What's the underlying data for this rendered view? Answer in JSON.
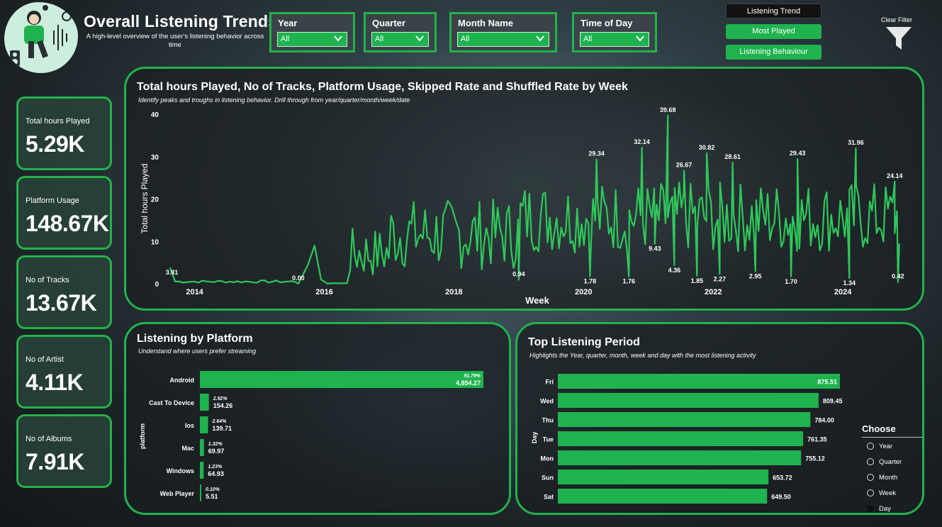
{
  "header": {
    "title": "Overall Listening Trends",
    "subtitle": "A high-level overview of the user's listening behavior across time"
  },
  "slicers": [
    {
      "label": "Year",
      "value": "All"
    },
    {
      "label": "Quarter",
      "value": "All"
    },
    {
      "label": "Month Name",
      "value": "All"
    },
    {
      "label": "Time of Day",
      "value": "All"
    }
  ],
  "nav": {
    "listening_trend": "Listening Trend",
    "most_played": "Most Played",
    "listening_behaviour": "Listening Behaviour",
    "clear_filter": "Clear Filter"
  },
  "kpis": [
    {
      "label": "Total hours Played",
      "value": "5.29K"
    },
    {
      "label": "Platform Usage",
      "value": "148.67K"
    },
    {
      "label": "No of Tracks",
      "value": "13.67K"
    },
    {
      "label": "No of Artist",
      "value": "4.11K"
    },
    {
      "label": "No of Albums",
      "value": "7.91K"
    }
  ],
  "colors": {
    "accent": "#22b24c",
    "line": "#2ec85a",
    "bar": "#1fb34f",
    "active_nav": "#121212"
  },
  "chart_data": [
    {
      "type": "line",
      "title": "Total hours Played, No of Tracks, Platform Usage, Skipped Rate and Shuffled Rate by Week",
      "subtitle": "Identify peaks and troughs in listening behavior. Drill through from year/quarter/month/week/date",
      "xlabel": "Week",
      "ylabel": "Total hours Played",
      "x_ticks": [
        "2014",
        "2016",
        "2018",
        "2020",
        "2022",
        "2024"
      ],
      "y_ticks": [
        0,
        10,
        20,
        30,
        40
      ],
      "ylim": [
        0,
        40
      ],
      "xlim": [
        2013.6,
        2024.95
      ],
      "annotations": [
        {
          "x": 2013.65,
          "y": 3.81,
          "label": "3.81"
        },
        {
          "x": 2015.6,
          "y": 0.0,
          "label": "0.00"
        },
        {
          "x": 2019.0,
          "y": 0.94,
          "label": "0.94"
        },
        {
          "x": 2020.1,
          "y": 1.78,
          "label": "1.78"
        },
        {
          "x": 2020.2,
          "y": 29.34,
          "label": "29.34"
        },
        {
          "x": 2020.7,
          "y": 1.76,
          "label": "1.76"
        },
        {
          "x": 2020.9,
          "y": 32.14,
          "label": "32.14"
        },
        {
          "x": 2021.1,
          "y": 9.43,
          "label": "9.43"
        },
        {
          "x": 2021.3,
          "y": 39.68,
          "label": "39.68"
        },
        {
          "x": 2021.4,
          "y": 4.36,
          "label": "4.36"
        },
        {
          "x": 2021.55,
          "y": 26.67,
          "label": "26.67"
        },
        {
          "x": 2021.75,
          "y": 1.85,
          "label": "1.85"
        },
        {
          "x": 2021.9,
          "y": 30.82,
          "label": "30.82"
        },
        {
          "x": 2022.1,
          "y": 2.27,
          "label": "2.27"
        },
        {
          "x": 2022.3,
          "y": 28.61,
          "label": "28.61"
        },
        {
          "x": 2022.65,
          "y": 2.95,
          "label": "2.95"
        },
        {
          "x": 2023.2,
          "y": 1.7,
          "label": "1.70"
        },
        {
          "x": 2023.3,
          "y": 29.43,
          "label": "29.43"
        },
        {
          "x": 2024.1,
          "y": 1.34,
          "label": "1.34"
        },
        {
          "x": 2024.2,
          "y": 31.96,
          "label": "31.96"
        },
        {
          "x": 2024.85,
          "y": 0.42,
          "label": "0.42"
        },
        {
          "x": 2024.8,
          "y": 24.14,
          "label": "24.14"
        }
      ]
    },
    {
      "type": "bar",
      "orientation": "horizontal",
      "title": "Listening by Platform",
      "subtitle": "Understand where users prefer streaming",
      "ylabel": "platform",
      "categories": [
        "Android",
        "Cast To Device",
        "Ios",
        "Mac",
        "Windows",
        "Web Player"
      ],
      "values": [
        4854.27,
        154.26,
        139.71,
        69.97,
        64.93,
        5.51
      ],
      "value_labels": [
        "4,854.27",
        "154.26",
        "139.71",
        "69.97",
        "64.93",
        "5.51"
      ],
      "percent_labels": [
        "91.79%",
        "2.92%",
        "2.64%",
        "1.32%",
        "1.23%",
        "0.10%"
      ]
    },
    {
      "type": "bar",
      "orientation": "horizontal",
      "title": "Top Listening Period",
      "subtitle": "Highlights the Year, quarter, month, week and day with the most listening activity",
      "ylabel": "Day",
      "categories": [
        "Fri",
        "Wed",
        "Thu",
        "Tue",
        "Mon",
        "Sun",
        "Sat"
      ],
      "values": [
        875.51,
        809.45,
        784.0,
        761.35,
        755.12,
        653.72,
        649.5
      ],
      "value_labels": [
        "875.51",
        "809.45",
        "784.00",
        "761.35",
        "755.12",
        "653.72",
        "649.50"
      ]
    }
  ],
  "choose": {
    "title": "Choose",
    "options": [
      "Year",
      "Quarter",
      "Month",
      "Week",
      "Day"
    ],
    "selected": "Day"
  }
}
